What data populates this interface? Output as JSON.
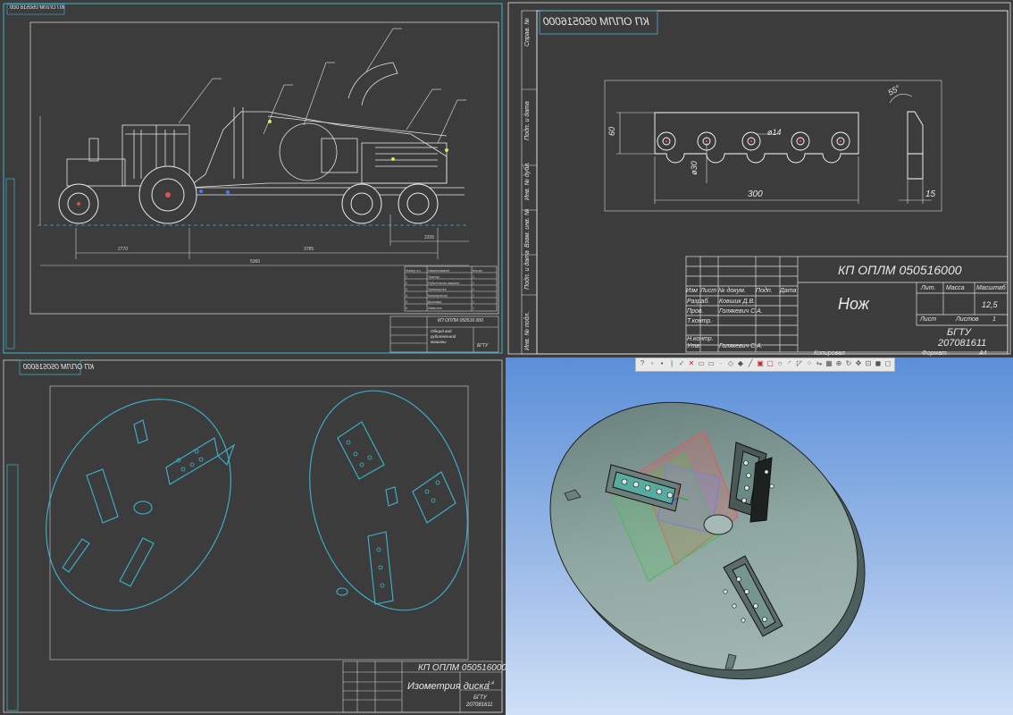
{
  "panes": {
    "top_left": {
      "stamp_code": "КП ОПЛМ 050516 000",
      "stamp_title": "Общий вид рубительной машины",
      "stamp_org": "БГТУ",
      "dims": [
        "2770",
        "3785",
        "5360",
        "2335"
      ],
      "spec_headers": [
        "Номер п.п.",
        "Наименование",
        "Кол-во"
      ],
      "spec_rows": [
        [
          "1",
          "Трактор",
          "1"
        ],
        [
          "2",
          "Рубительная машина",
          "1"
        ],
        [
          "3",
          "Транспортер",
          "1"
        ],
        [
          "4",
          "Манипулятор",
          "1"
        ],
        [
          "5",
          "Дисковая",
          "1"
        ],
        [
          "6",
          "Навесное",
          "1"
        ]
      ],
      "mirrored_code": "КП ОПЛМ 050516 000"
    },
    "top_right": {
      "mirrored_code": "КП ОПЛМ 050516000",
      "side_labels": [
        "Справ. №",
        "Подп. и дата",
        "Инв. № дубл.",
        "Взам. инв. №",
        "Подп. и дата",
        "Инв. № подл."
      ],
      "dim_60": "60",
      "dim_d14": "ø14",
      "dim_d30": "ø30",
      "dim_300": "300",
      "dim_15": "15",
      "dim_55": "55°",
      "stamp_code": "КП ОПЛМ 050516000",
      "stamp_title": "Нож",
      "col_headers": [
        "Изм",
        "Лист",
        "№ докум.",
        "Подп.",
        "Дата"
      ],
      "roles": [
        "Разраб.",
        "Пров.",
        "Т.контр.",
        "Н.контр.",
        "Утв."
      ],
      "names": [
        "Ковшик Д.В.",
        "Голякевич С.А.",
        "",
        "",
        "Голякевич С.А."
      ],
      "lit_label": "Лит.",
      "mass_label": "Масса",
      "scale_label": "Масштаб",
      "scale_value": "12,5",
      "sheet_label": "Лист",
      "sheets_label": "Листов",
      "sheets_value": "1",
      "org": "БГТУ",
      "group": "207081611",
      "copied": "Копировал",
      "format_label": "Формат",
      "format_value": "A4"
    },
    "bottom_left": {
      "mirrored_code": "КП ОПЛМ 050516000",
      "stamp_code": "КП ОПЛМ 050516000",
      "stamp_title": "Изометрия диска",
      "org": "БГТУ",
      "group": "207081611",
      "scale_value": "1:4"
    },
    "bottom_right": {
      "toolbar_icons": [
        "help-icon",
        "file-icon",
        "save-icon",
        "separator-icon",
        "check-icon",
        "close-icon",
        "sketch-icon",
        "sketch-icon",
        "point-icon",
        "plane-icon",
        "plane-icon",
        "axis-icon",
        "extrude-icon",
        "cut-icon",
        "hole-icon",
        "fillet-icon",
        "chamfer-icon",
        "pattern-icon",
        "mirror-icon",
        "view-icon",
        "zoom-icon",
        "rotate-icon",
        "pan-icon",
        "fit-icon",
        "shade-icon",
        "wire-icon"
      ],
      "bg_top": "#5a8fd8",
      "bg_bottom": "#cfe0f6",
      "part_color": "#8fa7a2"
    }
  }
}
